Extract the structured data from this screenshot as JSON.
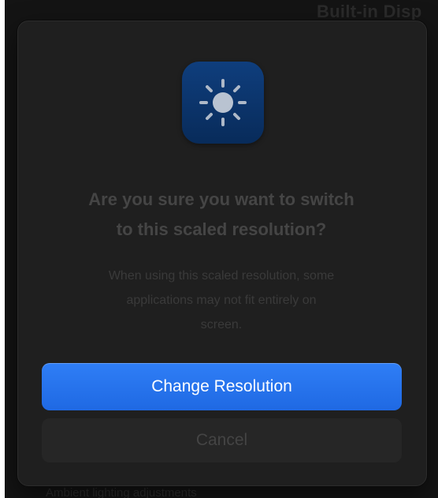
{
  "background": {
    "window_title": "Built-in Disp",
    "subtext": "Ambient lighting adjustments"
  },
  "dialog": {
    "icon": "brightness-sun-icon",
    "headline_line1": "Are you sure you want to switch",
    "headline_line2": "to this scaled resolution?",
    "message_line1": "When using this scaled resolution, some",
    "message_line2": "applications may not fit entirely on",
    "message_line3": "screen.",
    "confirm_label": "Change Resolution",
    "cancel_label": "Cancel"
  },
  "colors": {
    "primary_button": "#2a76f0",
    "icon_background": "#0c3670",
    "dialog_background": "#1f1f1f",
    "screen_background": "#141414"
  }
}
